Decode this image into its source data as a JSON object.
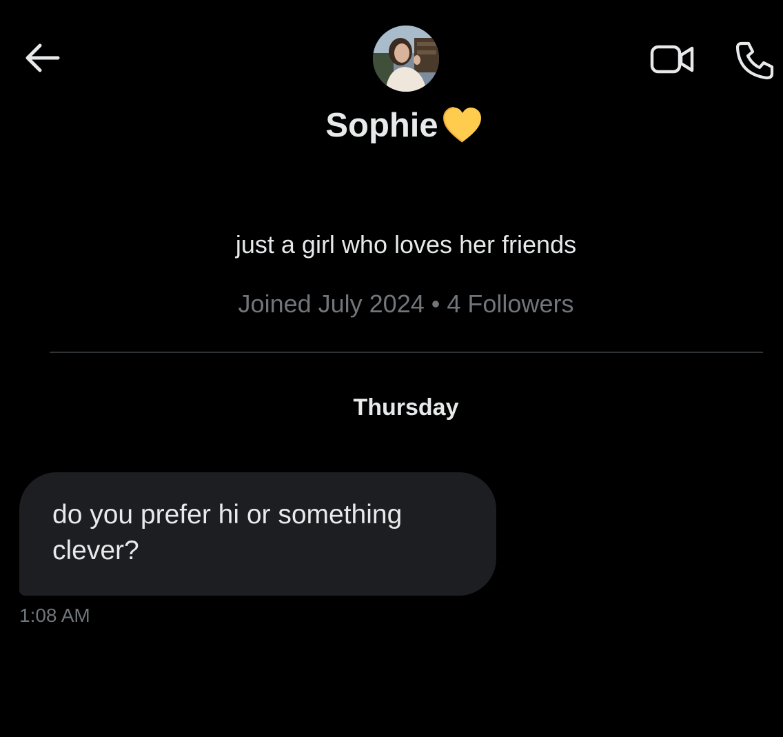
{
  "header": {
    "back_icon": "arrow-left-icon",
    "video_icon": "video-camera-icon",
    "call_icon": "phone-icon",
    "profile_name": "Sophie",
    "name_emoji_icon": "yellow-heart-icon"
  },
  "profile": {
    "bio": "just a girl who loves her friends",
    "joined": "Joined July 2024",
    "separator": "•",
    "followers": "4 Followers"
  },
  "conversation": {
    "day_label": "Thursday",
    "messages": [
      {
        "text": "do you prefer hi or something clever?",
        "time": "1:08 AM",
        "direction": "incoming"
      }
    ]
  },
  "colors": {
    "background": "#000000",
    "primary_text": "#e7e9ea",
    "secondary_text": "#71767b",
    "bubble": "#1c1e21",
    "divider": "#2f3336",
    "heart": "#ffcc4d"
  }
}
